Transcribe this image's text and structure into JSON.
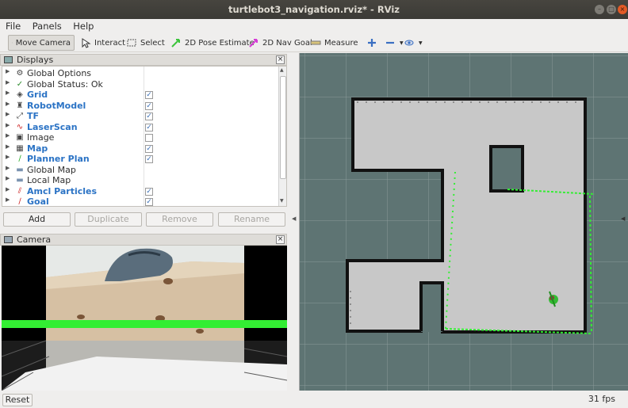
{
  "window": {
    "title": "turtlebot3_navigation.rviz* - RViz"
  },
  "menu": {
    "file": "File",
    "panels": "Panels",
    "help": "Help"
  },
  "toolbar": {
    "move_camera": "Move Camera",
    "interact": "Interact",
    "select": "Select",
    "pose_estimate": "2D Pose Estimate",
    "nav_goal": "2D Nav Goal",
    "measure": "Measure"
  },
  "displays": {
    "title": "Displays",
    "items": [
      {
        "label": "Global Options",
        "plugin": false,
        "checked": null,
        "icon": "gear-icon"
      },
      {
        "label": "Global Status: Ok",
        "plugin": false,
        "checked": null,
        "icon": "check-icon"
      },
      {
        "label": "Grid",
        "plugin": true,
        "checked": true,
        "icon": "grid-icon"
      },
      {
        "label": "RobotModel",
        "plugin": true,
        "checked": true,
        "icon": "robot-icon"
      },
      {
        "label": "TF",
        "plugin": true,
        "checked": true,
        "icon": "tf-icon"
      },
      {
        "label": "LaserScan",
        "plugin": true,
        "checked": true,
        "icon": "laser-icon"
      },
      {
        "label": "Image",
        "plugin": false,
        "checked": false,
        "icon": "image-icon"
      },
      {
        "label": "Map",
        "plugin": true,
        "checked": true,
        "icon": "map-icon"
      },
      {
        "label": "Planner Plan",
        "plugin": true,
        "checked": true,
        "icon": "path-icon"
      },
      {
        "label": "Global Map",
        "plugin": false,
        "checked": null,
        "icon": "folder-icon"
      },
      {
        "label": "Local Map",
        "plugin": false,
        "checked": null,
        "icon": "folder-icon"
      },
      {
        "label": "Amcl Particles",
        "plugin": true,
        "checked": true,
        "icon": "particles-icon"
      },
      {
        "label": "Goal",
        "plugin": true,
        "checked": true,
        "icon": "arrow-icon"
      }
    ],
    "buttons": {
      "add": "Add",
      "duplicate": "Duplicate",
      "remove": "Remove",
      "rename": "Rename"
    }
  },
  "camera": {
    "title": "Camera"
  },
  "statusbar": {
    "reset": "Reset",
    "fps": "31 fps"
  },
  "colors": {
    "grid_bg": "#5e7473",
    "free_space": "#c8c8c8",
    "walls": "#111111",
    "laser": "#33ff33",
    "plugin_blue": "#2b73c5"
  }
}
